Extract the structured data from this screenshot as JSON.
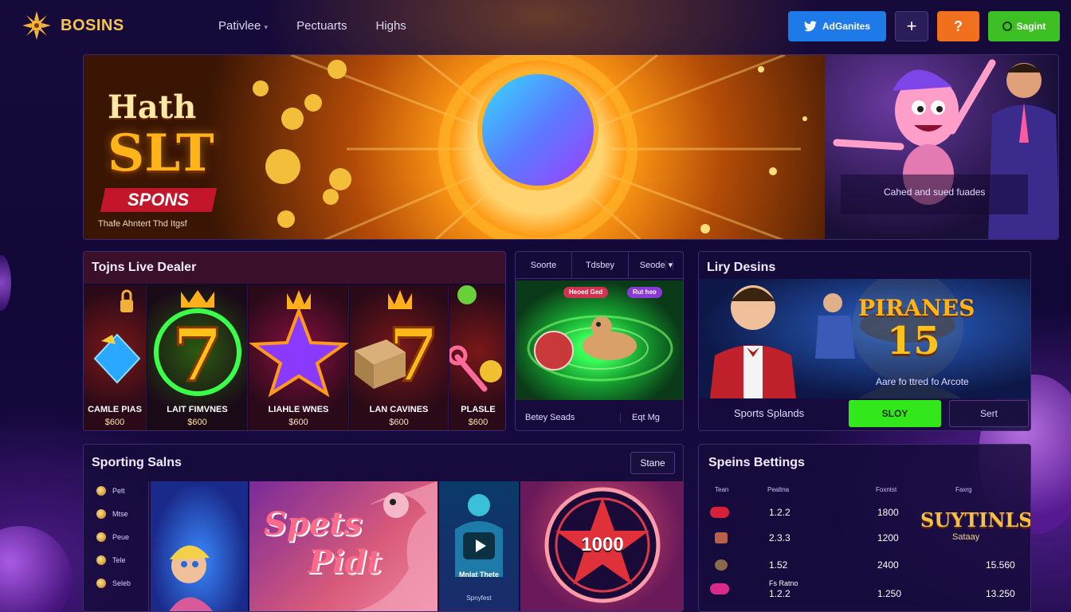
{
  "brand": {
    "name": "BOSINS"
  },
  "nav": {
    "items": [
      "Pativlee",
      "Pectuarts",
      "Highs"
    ]
  },
  "top_actions": {
    "blue_label": "AdGanites",
    "plus_label": "+",
    "orange_label": "?",
    "green_label": "Sagint"
  },
  "hero": {
    "title_line1": "Hath",
    "title_line2": "SLT",
    "badge": "SPONS",
    "subtitle": "Thafe Ahntert Thd Itgsf",
    "right_caption": "Cahed and sued fuades"
  },
  "live_dealer": {
    "title": "Tojns Live Dealer",
    "cards": [
      {
        "name": "CAMLE PIAS",
        "amount": "$600"
      },
      {
        "name": "LAIT FIMVNES",
        "amount": "$600"
      },
      {
        "name": "LIAHLE WNES",
        "amount": "$600"
      },
      {
        "name": "LAN CAVINES",
        "amount": "$600"
      },
      {
        "name": "PLASLE",
        "amount": "$600"
      }
    ]
  },
  "sports_panel": {
    "tabs": [
      "Soorte",
      "Tdsbey",
      "Seode"
    ],
    "chips": [
      "Heoed Ged",
      "Rut heo"
    ],
    "footer_left": "Betey Seads",
    "footer_right": "Eqt Mg"
  },
  "lucky": {
    "title": "Liry Desins",
    "art_text_1": "PIRANES",
    "art_text_2": "15",
    "art_text_3": "Aare fo ttred fo Arcote",
    "footer_label": "Sports Splands",
    "play_label": "SLOY",
    "secondary_label": "Sert"
  },
  "sporting": {
    "title": "Sporting Salns",
    "button": "Stane",
    "side_items": [
      "Pelt",
      "Mtse",
      "Peue",
      "Tele",
      "Seleb"
    ],
    "tile_text_1": "Spets",
    "tile_text_2": "Pidt",
    "video_caption": "Mnlat Thete",
    "video_sub": "Spnyfest",
    "star_value": "1000"
  },
  "betting": {
    "title": "Speins Bettings",
    "headers": [
      "Tean",
      "Pealtna",
      "Foxntst",
      "Faxrg"
    ],
    "rows": [
      {
        "v1": "1.2.2",
        "v2": "1800"
      },
      {
        "v1": "2.3.3",
        "v2": "1200"
      },
      {
        "v1": "1.52",
        "v2": "2400",
        "v3": "15.560"
      },
      {
        "v1": "1.2.2",
        "label": "Fs Ratno",
        "v2": "1.250",
        "v3": "13.250"
      }
    ],
    "art_text_1": "SUYTINLS",
    "art_text_2": "Sataay"
  },
  "colors": {
    "accent_green": "#33e81a",
    "accent_blue": "#1e7ae8",
    "accent_orange": "#f0701e",
    "gold": "#ffb51a"
  }
}
